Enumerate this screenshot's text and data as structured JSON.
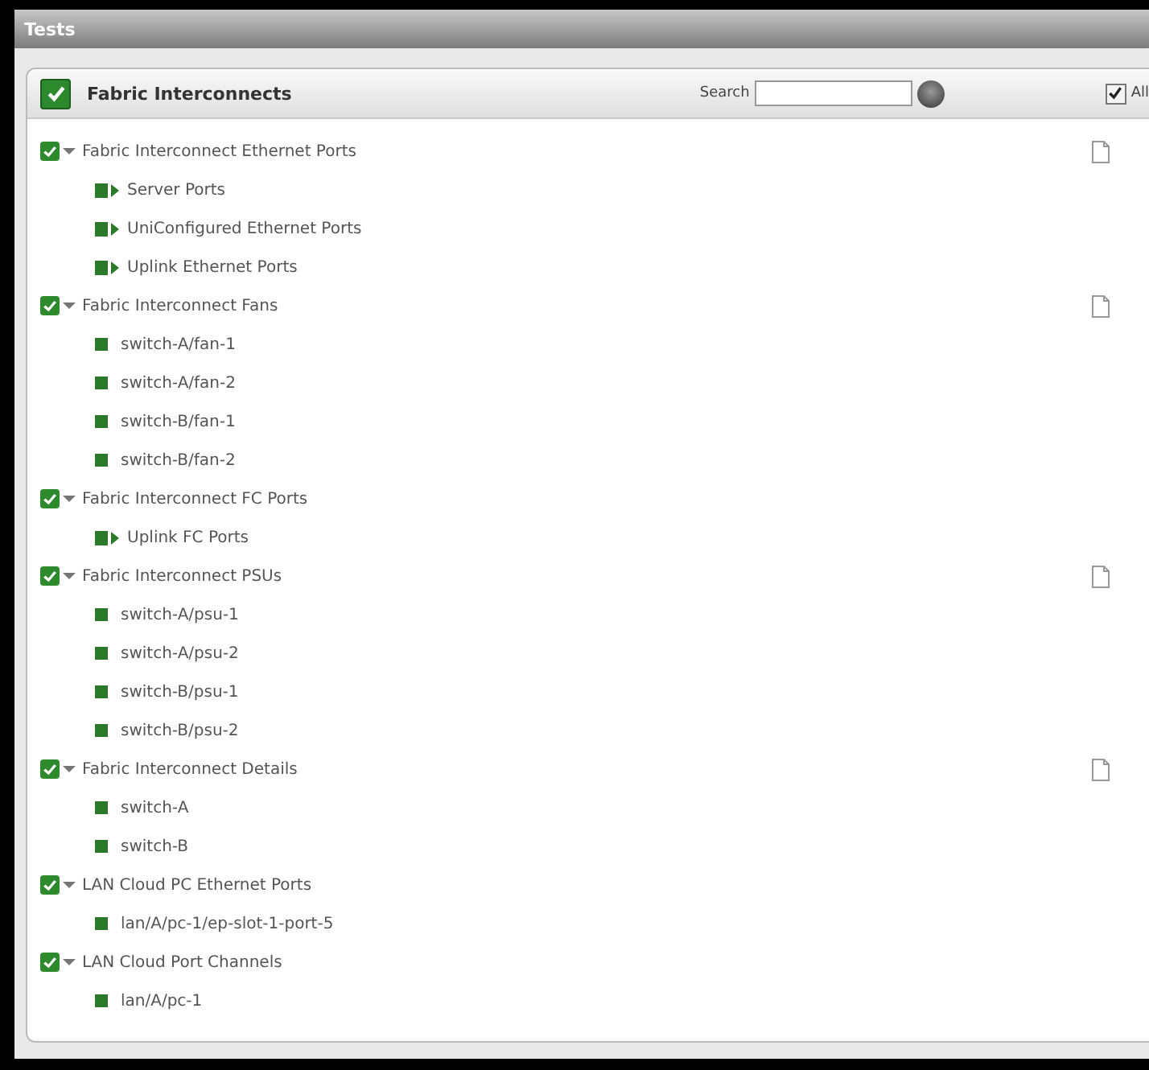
{
  "window": {
    "title": "Tests"
  },
  "panel": {
    "title": "Fabric Interconnects",
    "checked": true,
    "search": {
      "label": "Search"
    },
    "all": {
      "label": "All",
      "checked": true
    }
  },
  "groups": [
    {
      "label": "Fabric Interconnect Ethernet Ports",
      "checked": true,
      "expanded": true,
      "doc": true,
      "children": [
        {
          "label": "Server Ports",
          "kind": "folder"
        },
        {
          "label": "UniConfigured Ethernet Ports",
          "kind": "folder"
        },
        {
          "label": "Uplink Ethernet Ports",
          "kind": "folder"
        }
      ]
    },
    {
      "label": "Fabric Interconnect Fans",
      "checked": true,
      "expanded": true,
      "doc": true,
      "children": [
        {
          "label": "switch-A/fan-1",
          "kind": "leaf"
        },
        {
          "label": "switch-A/fan-2",
          "kind": "leaf"
        },
        {
          "label": "switch-B/fan-1",
          "kind": "leaf"
        },
        {
          "label": "switch-B/fan-2",
          "kind": "leaf"
        }
      ]
    },
    {
      "label": "Fabric Interconnect FC Ports",
      "checked": true,
      "expanded": true,
      "doc": false,
      "children": [
        {
          "label": "Uplink FC Ports",
          "kind": "folder"
        }
      ]
    },
    {
      "label": "Fabric Interconnect PSUs",
      "checked": true,
      "expanded": true,
      "doc": true,
      "children": [
        {
          "label": "switch-A/psu-1",
          "kind": "leaf"
        },
        {
          "label": "switch-A/psu-2",
          "kind": "leaf"
        },
        {
          "label": "switch-B/psu-1",
          "kind": "leaf"
        },
        {
          "label": "switch-B/psu-2",
          "kind": "leaf"
        }
      ]
    },
    {
      "label": "Fabric Interconnect Details",
      "checked": true,
      "expanded": true,
      "doc": true,
      "children": [
        {
          "label": "switch-A",
          "kind": "leaf"
        },
        {
          "label": "switch-B",
          "kind": "leaf"
        }
      ]
    },
    {
      "label": "LAN Cloud PC Ethernet Ports",
      "checked": true,
      "expanded": true,
      "doc": false,
      "children": [
        {
          "label": "lan/A/pc-1/ep-slot-1-port-5",
          "kind": "leaf"
        }
      ]
    },
    {
      "label": "LAN Cloud Port Channels",
      "checked": true,
      "expanded": true,
      "doc": false,
      "children": [
        {
          "label": "lan/A/pc-1",
          "kind": "leaf"
        }
      ]
    }
  ]
}
